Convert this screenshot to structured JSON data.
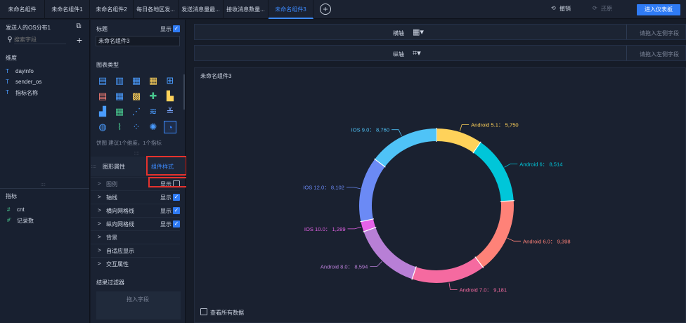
{
  "tabs": [
    {
      "label": "未命名组件",
      "active": false
    },
    {
      "label": "未命名组件1",
      "active": false
    },
    {
      "label": "未命名组件2",
      "active": false
    },
    {
      "label": "每日各地区发...",
      "active": false
    },
    {
      "label": "发送消息量最...",
      "active": false
    },
    {
      "label": "接收消息数量...",
      "active": false
    },
    {
      "label": "未命名组件3",
      "active": true
    }
  ],
  "toolbar": {
    "undo": "撤销",
    "redo": "还原",
    "enter": "进入仪表板",
    "undo_icon": "undo-icon",
    "redo_icon": "redo-icon"
  },
  "left": {
    "dataset": "发送人的OS分布1",
    "search_placeholder": "搜索字段",
    "dims_title": "维度",
    "dimensions": [
      "dayinfo",
      "sender_os",
      "指标名称"
    ],
    "measures_title": "指标",
    "measures": [
      {
        "label": "cnt",
        "icon": "#"
      },
      {
        "label": "记录数",
        "icon": "#'"
      }
    ],
    "dim_prefix": "T",
    "handle": "::::"
  },
  "mid": {
    "title_label": "标题",
    "show": "显示",
    "title_value": "未命名组件3",
    "chart_type_label": "图表类型",
    "hint": "饼图 建议1个维度，1个指标",
    "tab_props": "图形属性",
    "tab_style": "组件样式",
    "handle": "::::",
    "handle2": "::::",
    "sections": [
      {
        "label": "图例",
        "show": true,
        "checked": false,
        "muted": true
      },
      {
        "label": "轴线",
        "show": true,
        "checked": true
      },
      {
        "label": "横向网格线",
        "show": true,
        "checked": true
      },
      {
        "label": "纵向网格线",
        "show": true,
        "checked": true
      },
      {
        "label": "背景",
        "show": false
      },
      {
        "label": "自适应显示",
        "show": false
      },
      {
        "label": "交互属性",
        "show": false
      }
    ],
    "filter_title": "结果过滤器",
    "drop_hint": "拖入字段",
    "chevron": ">",
    "check": "✓"
  },
  "main": {
    "x_axis": "横轴",
    "y_axis": "纵轴",
    "drop_left": "请拖入左侧字段",
    "chart_title": "未命名组件3",
    "view_all": "查看所有数据"
  },
  "chart_data": {
    "type": "pie",
    "donut": true,
    "title": "未命名组件3",
    "slices": [
      {
        "label": "Android 5.1",
        "value": 5750,
        "color": "#ffd25a"
      },
      {
        "label": "Android 6",
        "value": 8514,
        "color": "#00c6d9"
      },
      {
        "label": "Android 6.0",
        "value": 9398,
        "color": "#ff8278"
      },
      {
        "label": "Android 7.0",
        "value": 9181,
        "color": "#f56aa0"
      },
      {
        "label": "Android 8.0",
        "value": 8594,
        "color": "#b87fd6"
      },
      {
        "label": "IOS 10.0",
        "value": 1289,
        "color": "#e663e8"
      },
      {
        "label": "IOS 12.0",
        "value": 8102,
        "color": "#6b8af5"
      },
      {
        "label": "IOS 9.0",
        "value": 8760,
        "color": "#4fc3f7"
      }
    ],
    "legend": false
  }
}
